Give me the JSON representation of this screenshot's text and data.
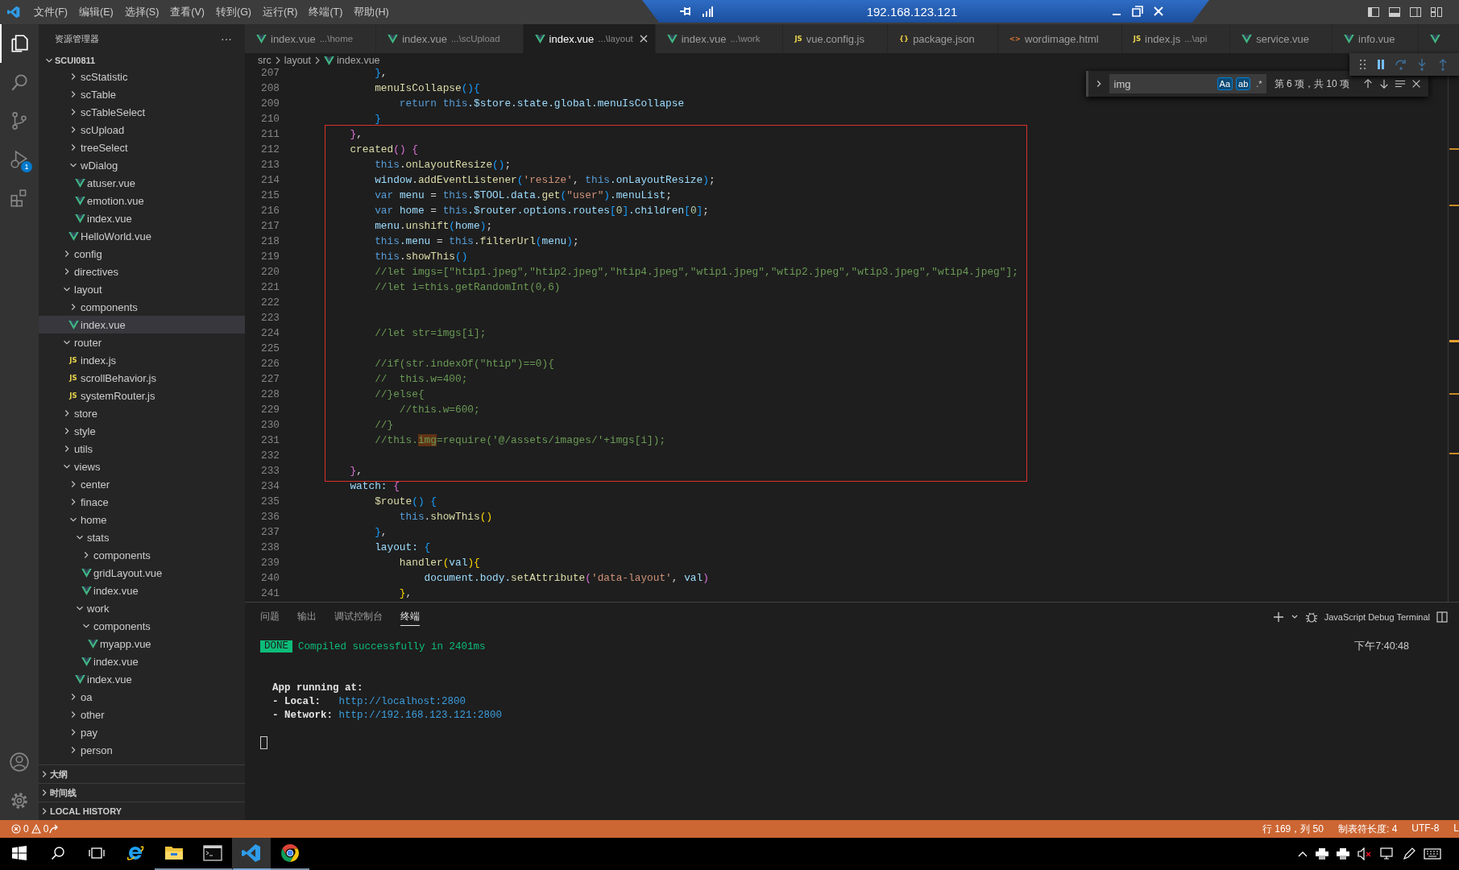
{
  "title_bar": {
    "menus": [
      "文件(F)",
      "编辑(E)",
      "选择(S)",
      "查看(V)",
      "转到(G)",
      "运行(R)",
      "终端(T)",
      "帮助(H)"
    ],
    "remote": {
      "address": "192.168.123.121"
    }
  },
  "activity_bar": {
    "items": [
      {
        "kind": "explorer",
        "selected": true
      },
      {
        "kind": "search",
        "selected": false
      },
      {
        "kind": "source-control",
        "selected": false
      },
      {
        "kind": "run-debug",
        "selected": false,
        "badge": "1"
      },
      {
        "kind": "extensions",
        "selected": false
      }
    ],
    "bottom": [
      {
        "kind": "account"
      },
      {
        "kind": "settings"
      }
    ]
  },
  "sidebar": {
    "title": "资源管理器",
    "more": "···",
    "root": {
      "label": "SCUI0811",
      "expanded": true
    },
    "scrolled_items": [
      {
        "label": "scStatistic",
        "kind": "folder",
        "expanded": false,
        "selected": false
      },
      {
        "label": "scTable",
        "kind": "folder",
        "expanded": false,
        "selected": false
      },
      {
        "label": "scTableSelect",
        "kind": "folder",
        "expanded": false,
        "selected": false
      },
      {
        "label": "scUpload",
        "kind": "folder",
        "expanded": false,
        "selected": false
      },
      {
        "label": "treeSelect",
        "kind": "folder",
        "expanded": false,
        "selected": false
      },
      {
        "label": "wDialog",
        "kind": "folder",
        "expanded": true,
        "selected": false,
        "children": [
          {
            "label": "atuser.vue",
            "kind": "vue",
            "selected": false
          },
          {
            "label": "emotion.vue",
            "kind": "vue",
            "selected": false
          },
          {
            "label": "index.vue",
            "kind": "vue",
            "selected": false
          }
        ]
      },
      {
        "label": "HelloWorld.vue",
        "kind": "vue",
        "selected": false
      }
    ],
    "items": [
      {
        "label": "config",
        "kind": "folder",
        "expanded": false,
        "selected": false
      },
      {
        "label": "directives",
        "kind": "folder",
        "expanded": false,
        "selected": false
      },
      {
        "label": "layout",
        "kind": "folder",
        "expanded": true,
        "selected": false,
        "children": [
          {
            "label": "components",
            "kind": "folder",
            "expanded": false,
            "selected": false
          },
          {
            "label": "index.vue",
            "kind": "vue",
            "selected": true
          }
        ]
      },
      {
        "label": "router",
        "kind": "folder",
        "expanded": true,
        "selected": false,
        "children": [
          {
            "label": "index.js",
            "kind": "js",
            "glyph": "JS",
            "selected": false
          },
          {
            "label": "scrollBehavior.js",
            "kind": "js",
            "glyph": "JS",
            "selected": false
          },
          {
            "label": "systemRouter.js",
            "kind": "js",
            "glyph": "JS",
            "selected": false
          }
        ]
      },
      {
        "label": "store",
        "kind": "folder",
        "expanded": false,
        "selected": false
      },
      {
        "label": "style",
        "kind": "folder",
        "expanded": false,
        "selected": false
      },
      {
        "label": "utils",
        "kind": "folder",
        "expanded": false,
        "selected": false
      },
      {
        "label": "views",
        "kind": "folder",
        "expanded": true,
        "selected": false,
        "children": [
          {
            "label": "center",
            "kind": "folder",
            "expanded": false,
            "selected": false
          },
          {
            "label": "finace",
            "kind": "folder",
            "expanded": false,
            "selected": false
          },
          {
            "label": "home",
            "kind": "folder",
            "expanded": true,
            "selected": false,
            "children": [
              {
                "label": "stats",
                "kind": "folder",
                "expanded": true,
                "selected": false,
                "children": [
                  {
                    "label": "components",
                    "kind": "folder",
                    "expanded": false,
                    "selected": false
                  },
                  {
                    "label": "gridLayout.vue",
                    "kind": "vue",
                    "selected": false
                  },
                  {
                    "label": "index.vue",
                    "kind": "vue",
                    "selected": false
                  }
                ]
              },
              {
                "label": "work",
                "kind": "folder",
                "expanded": true,
                "selected": false,
                "children": [
                  {
                    "label": "components",
                    "kind": "folder",
                    "expanded": true,
                    "selected": false,
                    "children": [
                      {
                        "label": "myapp.vue",
                        "kind": "vue",
                        "selected": false
                      }
                    ]
                  },
                  {
                    "label": "index.vue",
                    "kind": "vue",
                    "selected": false
                  }
                ]
              },
              {
                "label": "index.vue",
                "kind": "vue",
                "selected": false
              }
            ]
          },
          {
            "label": "oa",
            "kind": "folder",
            "expanded": false,
            "selected": false
          },
          {
            "label": "other",
            "kind": "folder",
            "expanded": false,
            "selected": false
          },
          {
            "label": "pay",
            "kind": "folder",
            "expanded": false,
            "selected": false
          },
          {
            "label": "person",
            "kind": "folder",
            "expanded": false,
            "selected": false
          }
        ]
      }
    ],
    "sections": [
      {
        "label": "大纲",
        "expanded": false
      },
      {
        "label": "时间线",
        "expanded": false
      },
      {
        "label": "LOCAL HISTORY",
        "expanded": false
      }
    ]
  },
  "tabs": [
    {
      "kind": "vue",
      "label": "index.vue",
      "description": "...\\home",
      "selected": false
    },
    {
      "kind": "vue",
      "label": "index.vue",
      "description": "...\\scUpload",
      "selected": false
    },
    {
      "kind": "vue",
      "label": "index.vue",
      "description": "...\\layout",
      "selected": true
    },
    {
      "kind": "vue",
      "label": "index.vue",
      "description": "...\\work",
      "selected": false
    },
    {
      "kind": "js",
      "glyph": "JS",
      "label": "vue.config.js",
      "selected": false
    },
    {
      "kind": "json",
      "glyph": "{}",
      "label": "package.json",
      "selected": false
    },
    {
      "kind": "html",
      "glyph": "<>",
      "label": "wordimage.html",
      "selected": false
    },
    {
      "kind": "js",
      "glyph": "JS",
      "label": "index.js",
      "description": "...\\api",
      "selected": false
    },
    {
      "kind": "vue",
      "label": "service.vue",
      "selected": false
    },
    {
      "kind": "vue",
      "label": "info.vue",
      "selected": false
    },
    {
      "kind": "vue",
      "selected": false
    }
  ],
  "breadcrumbs": [
    {
      "label": "src",
      "kind": "folder"
    },
    {
      "label": "layout",
      "kind": "folder"
    },
    {
      "label": "index.vue",
      "kind": "vue"
    }
  ],
  "find": {
    "query": "img",
    "options": [
      {
        "glyph": "Aa",
        "on": true
      },
      {
        "glyph": "ab",
        "on": true
      },
      {
        "glyph": ".*",
        "on": false
      }
    ],
    "result": "第 6 项，共 10 项"
  },
  "editor": {
    "blocks": [
      {
        "boxed": false,
        "lines": [
          {
            "number": "207",
            "tokens": [
              {
                "text": "            }",
                "kind": "b3"
              },
              {
                "text": ",",
                "kind": "p"
              }
            ]
          },
          {
            "number": "208",
            "tokens": [
              {
                "text": "            menuIsCollapse",
                "kind": "f"
              },
              {
                "text": "(){",
                "kind": "b3"
              }
            ]
          },
          {
            "number": "209",
            "tokens": [
              {
                "text": "                return ",
                "kind": "k"
              },
              {
                "text": "this",
                "kind": "k"
              },
              {
                "text": ".$store.state.global.menuIsCollapse",
                "kind": "v"
              }
            ]
          },
          {
            "number": "210",
            "tokens": [
              {
                "text": "            }",
                "kind": "b3"
              }
            ]
          }
        ]
      },
      {
        "boxed": true,
        "lines": [
          {
            "number": "211",
            "tokens": [
              {
                "text": "        }",
                "kind": "b2"
              },
              {
                "text": ",",
                "kind": "p"
              }
            ]
          },
          {
            "number": "212",
            "tokens": [
              {
                "text": "        created",
                "kind": "f"
              },
              {
                "text": "()",
                "kind": "b2"
              },
              {
                "text": " {",
                "kind": "b2"
              }
            ]
          },
          {
            "number": "213",
            "tokens": [
              {
                "text": "            this",
                "kind": "k"
              },
              {
                "text": ".",
                "kind": "p"
              },
              {
                "text": "onLayoutResize",
                "kind": "f"
              },
              {
                "text": "()",
                "kind": "b3"
              },
              {
                "text": ";",
                "kind": "p"
              }
            ]
          },
          {
            "number": "214",
            "tokens": [
              {
                "text": "            window",
                "kind": "v"
              },
              {
                "text": ".",
                "kind": "p"
              },
              {
                "text": "addEventListener",
                "kind": "f"
              },
              {
                "text": "(",
                "kind": "b3"
              },
              {
                "text": "'resize'",
                "kind": "s"
              },
              {
                "text": ", ",
                "kind": "p"
              },
              {
                "text": "this",
                "kind": "k"
              },
              {
                "text": ".onLayoutResize",
                "kind": "v"
              },
              {
                "text": ")",
                "kind": "b3"
              },
              {
                "text": ";",
                "kind": "p"
              }
            ]
          },
          {
            "number": "215",
            "tokens": [
              {
                "text": "            var",
                "kind": "k"
              },
              {
                "text": " menu ",
                "kind": "v"
              },
              {
                "text": "= ",
                "kind": "p"
              },
              {
                "text": "this",
                "kind": "k"
              },
              {
                "text": ".$TOOL.data.",
                "kind": "v"
              },
              {
                "text": "get",
                "kind": "f"
              },
              {
                "text": "(",
                "kind": "b3"
              },
              {
                "text": "\"user\"",
                "kind": "s"
              },
              {
                "text": ")",
                "kind": "b3"
              },
              {
                "text": ".menuList",
                "kind": "v"
              },
              {
                "text": ";",
                "kind": "p"
              }
            ]
          },
          {
            "number": "216",
            "tokens": [
              {
                "text": "            var",
                "kind": "k"
              },
              {
                "text": " home ",
                "kind": "v"
              },
              {
                "text": "= ",
                "kind": "p"
              },
              {
                "text": "this",
                "kind": "k"
              },
              {
                "text": ".$router.options.routes",
                "kind": "v"
              },
              {
                "text": "[",
                "kind": "b3"
              },
              {
                "text": "0",
                "kind": "n"
              },
              {
                "text": "]",
                "kind": "b3"
              },
              {
                "text": ".children",
                "kind": "v"
              },
              {
                "text": "[",
                "kind": "b3"
              },
              {
                "text": "0",
                "kind": "n"
              },
              {
                "text": "]",
                "kind": "b3"
              },
              {
                "text": ";",
                "kind": "p"
              }
            ]
          },
          {
            "number": "217",
            "tokens": [
              {
                "text": "            menu",
                "kind": "v"
              },
              {
                "text": ".",
                "kind": "p"
              },
              {
                "text": "unshift",
                "kind": "f"
              },
              {
                "text": "(",
                "kind": "b3"
              },
              {
                "text": "home",
                "kind": "v"
              },
              {
                "text": ")",
                "kind": "b3"
              },
              {
                "text": ";",
                "kind": "p"
              }
            ]
          },
          {
            "number": "218",
            "tokens": [
              {
                "text": "            this",
                "kind": "k"
              },
              {
                "text": ".menu ",
                "kind": "v"
              },
              {
                "text": "= ",
                "kind": "p"
              },
              {
                "text": "this",
                "kind": "k"
              },
              {
                "text": ".",
                "kind": "p"
              },
              {
                "text": "filterUrl",
                "kind": "f"
              },
              {
                "text": "(",
                "kind": "b3"
              },
              {
                "text": "menu",
                "kind": "v"
              },
              {
                "text": ")",
                "kind": "b3"
              },
              {
                "text": ";",
                "kind": "p"
              }
            ]
          },
          {
            "number": "219",
            "tokens": [
              {
                "text": "            this",
                "kind": "k"
              },
              {
                "text": ".",
                "kind": "p"
              },
              {
                "text": "showThis",
                "kind": "f"
              },
              {
                "text": "()",
                "kind": "b3"
              }
            ]
          },
          {
            "number": "220",
            "tokens": [
              {
                "text": "            //let imgs=[\"htip1.jpeg\",\"htip2.jpeg\",\"htip4.jpeg\",\"wtip1.jpeg\",\"wtip2.jpeg\",\"wtip3.jpeg\",\"wtip4.jpeg\"];",
                "kind": "c"
              }
            ]
          },
          {
            "number": "221",
            "tokens": [
              {
                "text": "            //let i=this.getRandomInt(0,6)",
                "kind": "c"
              }
            ]
          },
          {
            "number": "222"
          },
          {
            "number": "223"
          },
          {
            "number": "224",
            "tokens": [
              {
                "text": "            //let str=imgs[i];",
                "kind": "c"
              }
            ]
          },
          {
            "number": "225"
          },
          {
            "number": "226",
            "tokens": [
              {
                "text": "            //if(str.indexOf(\"htip\")==0){",
                "kind": "c"
              }
            ]
          },
          {
            "number": "227",
            "tokens": [
              {
                "text": "            //  this.w=400;",
                "kind": "c"
              }
            ]
          },
          {
            "number": "228",
            "tokens": [
              {
                "text": "            //}else{",
                "kind": "c"
              }
            ]
          },
          {
            "number": "229",
            "tokens": [
              {
                "text": "                //this.w=600;",
                "kind": "c"
              }
            ]
          },
          {
            "number": "230",
            "tokens": [
              {
                "text": "            //}",
                "kind": "c"
              }
            ]
          },
          {
            "number": "231",
            "tokens": [
              {
                "text": "            //this.",
                "kind": "c"
              },
              {
                "text": "img",
                "kind": "m"
              },
              {
                "text": "=require('@/assets/images/'+imgs[i]);",
                "kind": "c"
              }
            ]
          },
          {
            "number": "232"
          },
          {
            "number": "233",
            "tokens": [
              {
                "text": "        }",
                "kind": "b2"
              },
              {
                "text": ",",
                "kind": "p"
              }
            ]
          }
        ]
      },
      {
        "boxed": false,
        "lines": [
          {
            "number": "234",
            "tokens": [
              {
                "text": "        watch: ",
                "kind": "v"
              },
              {
                "text": "{",
                "kind": "b2"
              }
            ]
          },
          {
            "number": "235",
            "tokens": [
              {
                "text": "            $route",
                "kind": "f"
              },
              {
                "text": "()",
                "kind": "b3"
              },
              {
                "text": " {",
                "kind": "b3"
              }
            ]
          },
          {
            "number": "236",
            "tokens": [
              {
                "text": "                this",
                "kind": "k"
              },
              {
                "text": ".",
                "kind": "p"
              },
              {
                "text": "showThis",
                "kind": "f"
              },
              {
                "text": "()",
                "kind": "b1"
              }
            ]
          },
          {
            "number": "237",
            "tokens": [
              {
                "text": "            }",
                "kind": "b3"
              },
              {
                "text": ",",
                "kind": "p"
              }
            ]
          },
          {
            "number": "238",
            "tokens": [
              {
                "text": "            layout: ",
                "kind": "v"
              },
              {
                "text": "{",
                "kind": "b3"
              }
            ]
          },
          {
            "number": "239",
            "tokens": [
              {
                "text": "                handler",
                "kind": "f"
              },
              {
                "text": "(",
                "kind": "b1"
              },
              {
                "text": "val",
                "kind": "v"
              },
              {
                "text": ")",
                "kind": "b1"
              },
              {
                "text": "{",
                "kind": "b1"
              }
            ]
          },
          {
            "number": "240",
            "tokens": [
              {
                "text": "                    document",
                "kind": "v"
              },
              {
                "text": ".body.",
                "kind": "v"
              },
              {
                "text": "setAttribute",
                "kind": "f"
              },
              {
                "text": "(",
                "kind": "b2"
              },
              {
                "text": "'data-layout'",
                "kind": "s"
              },
              {
                "text": ", ",
                "kind": "p"
              },
              {
                "text": "val",
                "kind": "v"
              },
              {
                "text": ")",
                "kind": "b2"
              }
            ]
          },
          {
            "number": "241",
            "tokens": [
              {
                "text": "                }",
                "kind": "b1"
              },
              {
                "text": ",",
                "kind": "p"
              }
            ]
          }
        ]
      }
    ]
  },
  "panel": {
    "tabs": [
      {
        "label": "问题",
        "selected": false
      },
      {
        "label": "输出",
        "selected": false
      },
      {
        "label": "调试控制台",
        "selected": false
      },
      {
        "label": "终端",
        "selected": true
      }
    ],
    "terminal_profile": "JavaScript Debug Terminal",
    "terminal": {
      "badge": "DONE",
      "message": "Compiled successfully in 2401ms",
      "time": "下午7:40:48",
      "heading": "App running at:",
      "entries": [
        {
          "label": "- Local:   ",
          "link": "http://localhost:2800"
        },
        {
          "label": "- Network: ",
          "link": "http://192.168.123.121:2800"
        }
      ]
    }
  },
  "status_bar": {
    "errors": "0",
    "warnings": "0",
    "items": [
      "行 169，列 50",
      "制表符长度: 4",
      "UTF-8",
      "L"
    ]
  },
  "taskbar": {
    "apps": [
      {
        "kind": "start",
        "running": false,
        "active": false
      },
      {
        "kind": "search",
        "running": false,
        "active": false
      },
      {
        "kind": "task-view",
        "running": false,
        "active": false
      },
      {
        "kind": "browser-e",
        "running": false,
        "active": false
      },
      {
        "kind": "explorer",
        "running": true,
        "active": false
      },
      {
        "kind": "terminal",
        "running": true,
        "active": false
      },
      {
        "kind": "code-editor",
        "running": true,
        "active": true
      },
      {
        "kind": "browser-round",
        "running": true,
        "active": false
      }
    ],
    "tray": [
      {
        "kind": "caret"
      },
      {
        "kind": "printer"
      },
      {
        "kind": "printer"
      },
      {
        "kind": "speaker-muted"
      },
      {
        "kind": "monitor"
      },
      {
        "kind": "pen"
      },
      {
        "kind": "keyboard"
      }
    ]
  }
}
